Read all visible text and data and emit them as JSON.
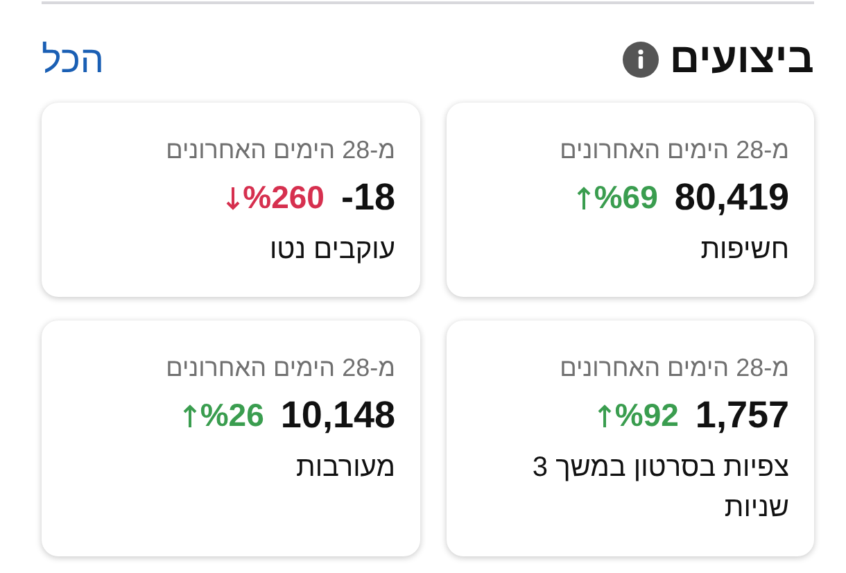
{
  "header": {
    "title": "ביצועים",
    "link": "הכל"
  },
  "cards": [
    {
      "period": "מ-28 הימים האחרונים",
      "value": "80,419",
      "change": "%69",
      "kind": "up",
      "label": "חשיפות"
    },
    {
      "period": "מ-28 הימים האחרונים",
      "value": "-18",
      "change": "%260",
      "kind": "down",
      "label": "עוקבים נטו"
    },
    {
      "period": "מ-28 הימים האחרונים",
      "value": "1,757",
      "change": "%92",
      "kind": "up",
      "label": "צפיות בסרטון במשך 3 שניות"
    },
    {
      "period": "מ-28 הימים האחרונים",
      "value": "10,148",
      "change": "%26",
      "kind": "up",
      "label": "מעורבות"
    }
  ]
}
